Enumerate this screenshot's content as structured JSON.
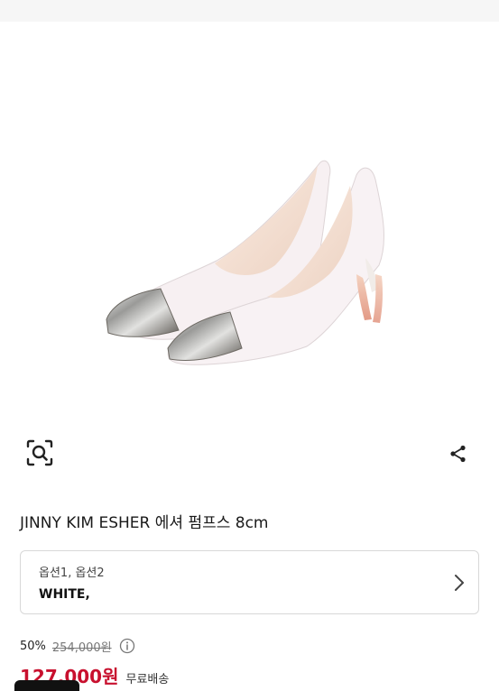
{
  "colors": {
    "sale_price": "#c8102e",
    "border": "#d8d8d8"
  },
  "icons": {
    "lens": "image-search-icon",
    "share": "share-icon",
    "chevron": "chevron-right-icon",
    "info": "info-icon"
  },
  "product": {
    "title": "JINNY KIM ESHER 에셔 펌프스 8cm",
    "option_label": "옵션1, 옵션2",
    "option_value": "WHITE,",
    "discount": "50%",
    "original_price": "254,000원",
    "sale_price": "127,000원",
    "shipping": "무료배송"
  }
}
